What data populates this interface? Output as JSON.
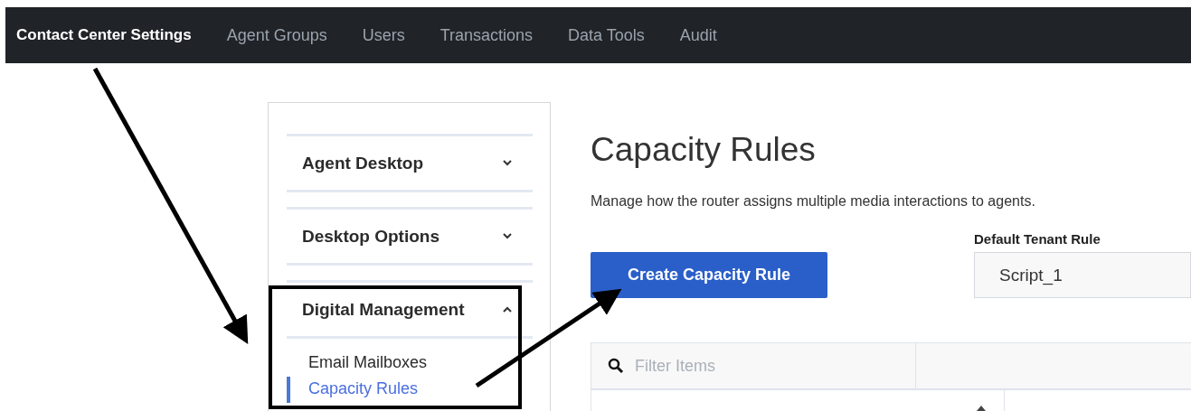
{
  "nav": {
    "items": [
      {
        "label": "Contact Center Settings",
        "selected": true
      },
      {
        "label": "Agent Groups",
        "selected": false
      },
      {
        "label": "Users",
        "selected": false
      },
      {
        "label": "Transactions",
        "selected": false
      },
      {
        "label": "Data Tools",
        "selected": false
      },
      {
        "label": "Audit",
        "selected": false
      }
    ]
  },
  "sidebar": {
    "sections": [
      {
        "title": "Agent Desktop",
        "expanded": false
      },
      {
        "title": "Desktop Options",
        "expanded": false
      },
      {
        "title": "Digital Management",
        "expanded": true,
        "children": [
          {
            "label": "Email Mailboxes",
            "selected": false
          },
          {
            "label": "Capacity Rules",
            "selected": true
          }
        ]
      }
    ]
  },
  "main": {
    "title": "Capacity Rules",
    "description": "Manage how the router assigns multiple media interactions to agents.",
    "create_button": "Create Capacity Rule",
    "default_rule": {
      "label": "Default Tenant Rule",
      "value": "Script_1"
    },
    "filter": {
      "placeholder": "Filter Items"
    }
  }
}
